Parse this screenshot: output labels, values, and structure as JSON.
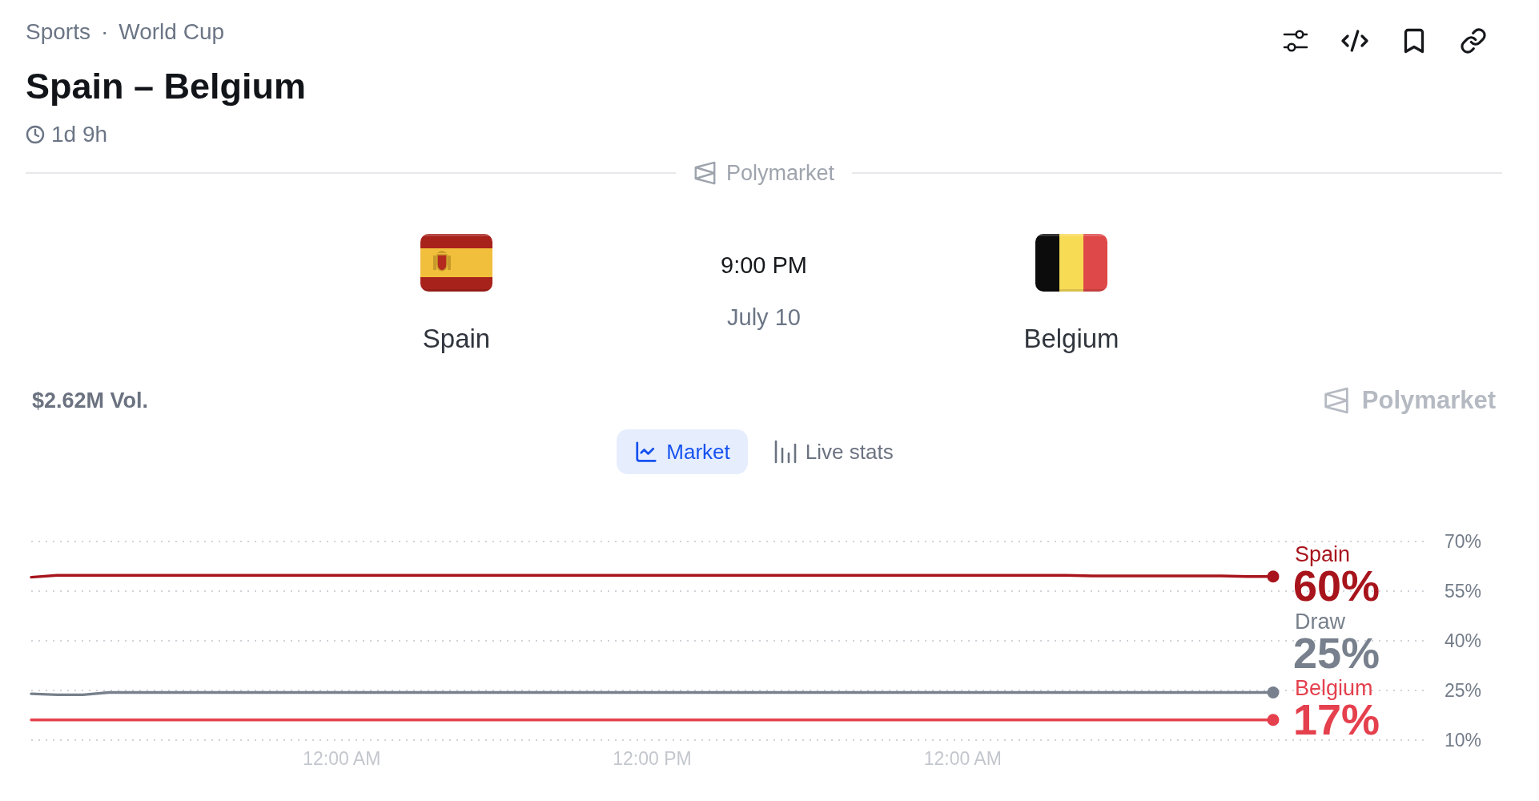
{
  "breadcrumb": {
    "items": [
      "Sports",
      "World Cup"
    ],
    "separator": "·"
  },
  "title": "Spain – Belgium",
  "countdown": "1d 9h",
  "source_divider": {
    "label": "Polymarket"
  },
  "match": {
    "teams": [
      {
        "name": "Spain"
      },
      {
        "name": "Belgium"
      }
    ],
    "time": "9:00 PM",
    "date": "July 10"
  },
  "volume": "$2.62M Vol.",
  "brand": "Polymarket",
  "tabs": [
    {
      "label": "Market",
      "selected": true
    },
    {
      "label": "Live stats",
      "selected": false
    }
  ],
  "chart": {
    "chart_data": {
      "type": "line",
      "categories": [
        null,
        null,
        null,
        null,
        null,
        null,
        null,
        null,
        null,
        null,
        null,
        null,
        "12:00 AM",
        null,
        null,
        null,
        null,
        null,
        null,
        null,
        null,
        null,
        null,
        null,
        "12:00 PM",
        null,
        null,
        null,
        null,
        null,
        null,
        null,
        null,
        null,
        null,
        null,
        "12:00 AM",
        null,
        null,
        null,
        null,
        null,
        null,
        null,
        null,
        null,
        null,
        null,
        null
      ],
      "series": [
        {
          "name": "Spain",
          "color": "#a8141c",
          "values": [
            59.2,
            59.8,
            59.8,
            59.8,
            59.8,
            59.8,
            59.8,
            59.8,
            59.8,
            59.8,
            59.8,
            59.8,
            59.8,
            59.8,
            59.8,
            59.8,
            59.8,
            59.8,
            59.8,
            59.8,
            59.8,
            59.8,
            59.8,
            59.8,
            59.8,
            59.8,
            59.8,
            59.8,
            59.8,
            59.8,
            59.8,
            59.8,
            59.8,
            59.8,
            59.8,
            59.8,
            59.8,
            59.8,
            59.8,
            59.8,
            59.8,
            59.6,
            59.6,
            59.6,
            59.6,
            59.6,
            59.6,
            59.4,
            59.4
          ]
        },
        {
          "name": "Draw",
          "color": "#77808c",
          "values": [
            24.0,
            23.7,
            23.7,
            24.4,
            24.4,
            24.4,
            24.4,
            24.4,
            24.4,
            24.4,
            24.4,
            24.4,
            24.4,
            24.4,
            24.4,
            24.4,
            24.4,
            24.4,
            24.4,
            24.4,
            24.4,
            24.4,
            24.4,
            24.4,
            24.4,
            24.4,
            24.4,
            24.4,
            24.4,
            24.4,
            24.4,
            24.4,
            24.4,
            24.4,
            24.4,
            24.4,
            24.4,
            24.4,
            24.4,
            24.4,
            24.4,
            24.4,
            24.4,
            24.4,
            24.4,
            24.4,
            24.4,
            24.4,
            24.4
          ]
        },
        {
          "name": "Belgium",
          "color": "#e5404d",
          "values": [
            16.1,
            16.1,
            16.1,
            16.1,
            16.1,
            16.1,
            16.1,
            16.1,
            16.1,
            16.1,
            16.1,
            16.1,
            16.1,
            16.1,
            16.1,
            16.1,
            16.1,
            16.1,
            16.1,
            16.1,
            16.1,
            16.1,
            16.1,
            16.1,
            16.1,
            16.1,
            16.1,
            16.1,
            16.1,
            16.1,
            16.1,
            16.1,
            16.1,
            16.1,
            16.1,
            16.1,
            16.1,
            16.1,
            16.1,
            16.1,
            16.1,
            16.1,
            16.1,
            16.1,
            16.1,
            16.1,
            16.1,
            16.1,
            16.1
          ]
        }
      ],
      "ylim": [
        10,
        70
      ],
      "yticks": [
        {
          "value": 70,
          "label": "70%"
        },
        {
          "value": 55,
          "label": "55%"
        },
        {
          "value": 40,
          "label": "40%"
        },
        {
          "value": 25,
          "label": "25%"
        },
        {
          "value": 10,
          "label": "10%"
        }
      ],
      "grid": true,
      "annotations": [
        {
          "text": "60%"
        },
        {
          "text": "25%"
        },
        {
          "text": "17%"
        }
      ]
    }
  }
}
